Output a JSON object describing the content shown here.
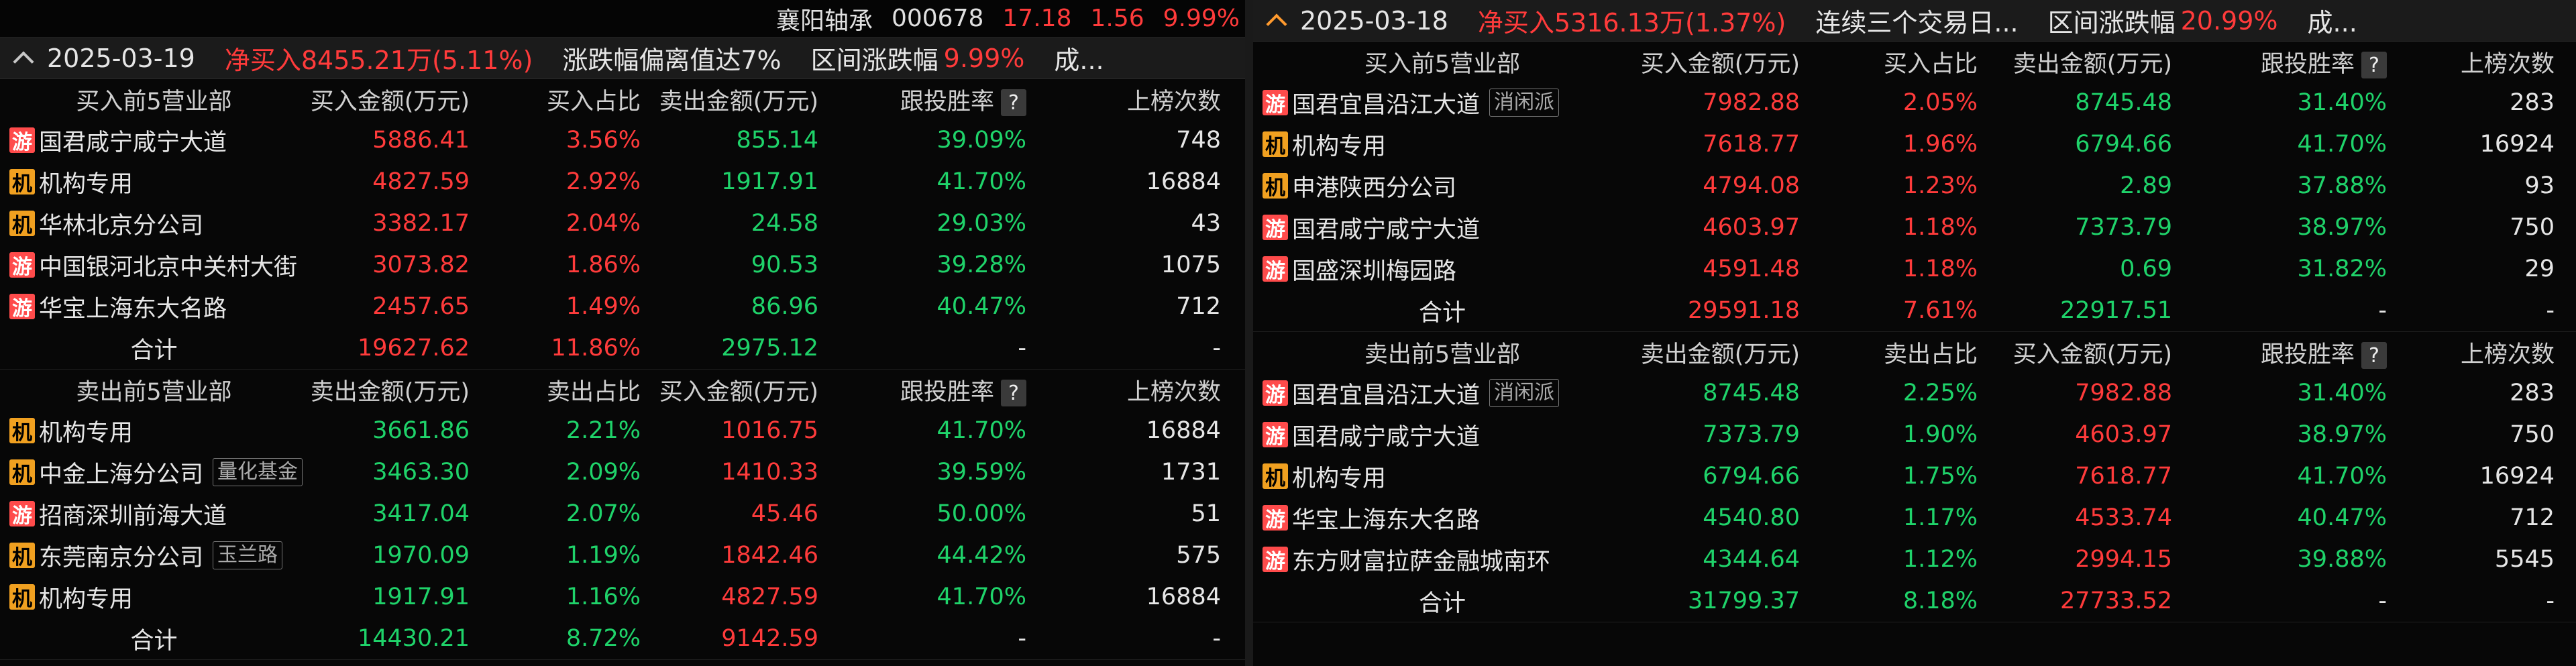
{
  "stock": {
    "name": "襄阳轴承",
    "code": "000678",
    "price": "17.18",
    "change": "1.56",
    "pct": "9.99%"
  },
  "left": {
    "date": "2025-03-19",
    "net": "净买入8455.21万(5.11%)",
    "reason": "涨跌幅偏离值达7%",
    "range_label": "区间涨跌幅",
    "range_value": "9.99%",
    "more": "成...",
    "buy": {
      "headers": [
        "买入前5营业部",
        "买入金额(万元)",
        "买入占比",
        "卖出金额(万元)",
        "跟投胜率",
        "上榜次数"
      ],
      "rows": [
        {
          "tag": "游",
          "name": "国君咸宁咸宁大道",
          "badge": "",
          "a": "5886.41",
          "p": "3.56%",
          "b": "855.14",
          "w": "39.09%",
          "n": "748"
        },
        {
          "tag": "机",
          "name": "机构专用",
          "badge": "",
          "a": "4827.59",
          "p": "2.92%",
          "b": "1917.91",
          "w": "41.70%",
          "n": "16884"
        },
        {
          "tag": "机",
          "name": "华林北京分公司",
          "badge": "",
          "a": "3382.17",
          "p": "2.04%",
          "b": "24.58",
          "w": "29.03%",
          "n": "43"
        },
        {
          "tag": "游",
          "name": "中国银河北京中关村大街",
          "badge": "",
          "a": "3073.82",
          "p": "1.86%",
          "b": "90.53",
          "w": "39.28%",
          "n": "1075"
        },
        {
          "tag": "游",
          "name": "华宝上海东大名路",
          "badge": "",
          "a": "2457.65",
          "p": "1.49%",
          "b": "86.96",
          "w": "40.47%",
          "n": "712"
        }
      ],
      "total": {
        "name": "合计",
        "a": "19627.62",
        "p": "11.86%",
        "b": "2975.12",
        "w": "-",
        "n": "-"
      }
    },
    "sell": {
      "headers": [
        "卖出前5营业部",
        "卖出金额(万元)",
        "卖出占比",
        "买入金额(万元)",
        "跟投胜率",
        "上榜次数"
      ],
      "rows": [
        {
          "tag": "机",
          "name": "机构专用",
          "badge": "",
          "a": "3661.86",
          "p": "2.21%",
          "b": "1016.75",
          "w": "41.70%",
          "n": "16884"
        },
        {
          "tag": "机",
          "name": "中金上海分公司",
          "badge": "量化基金",
          "a": "3463.30",
          "p": "2.09%",
          "b": "1410.33",
          "w": "39.59%",
          "n": "1731"
        },
        {
          "tag": "游",
          "name": "招商深圳前海大道",
          "badge": "",
          "a": "3417.04",
          "p": "2.07%",
          "b": "45.46",
          "w": "50.00%",
          "n": "51"
        },
        {
          "tag": "机",
          "name": "东莞南京分公司",
          "badge": "玉兰路",
          "a": "1970.09",
          "p": "1.19%",
          "b": "1842.46",
          "w": "44.42%",
          "n": "575"
        },
        {
          "tag": "机",
          "name": "机构专用",
          "badge": "",
          "a": "1917.91",
          "p": "1.16%",
          "b": "4827.59",
          "w": "41.70%",
          "n": "16884"
        }
      ],
      "total": {
        "name": "合计",
        "a": "14430.21",
        "p": "8.72%",
        "b": "9142.59",
        "w": "-",
        "n": "-"
      }
    }
  },
  "right": {
    "date": "2025-03-18",
    "net": "净买入5316.13万(1.37%)",
    "reason": "连续三个交易日...",
    "range_label": "区间涨跌幅",
    "range_value": "20.99%",
    "more": "成...",
    "buy": {
      "headers": [
        "买入前5营业部",
        "买入金额(万元)",
        "买入占比",
        "卖出金额(万元)",
        "跟投胜率",
        "上榜次数"
      ],
      "rows": [
        {
          "tag": "游",
          "name": "国君宜昌沿江大道",
          "badge": "消闲派",
          "a": "7982.88",
          "p": "2.05%",
          "b": "8745.48",
          "w": "31.40%",
          "n": "283"
        },
        {
          "tag": "机",
          "name": "机构专用",
          "badge": "",
          "a": "7618.77",
          "p": "1.96%",
          "b": "6794.66",
          "w": "41.70%",
          "n": "16924"
        },
        {
          "tag": "机",
          "name": "申港陕西分公司",
          "badge": "",
          "a": "4794.08",
          "p": "1.23%",
          "b": "2.89",
          "w": "37.88%",
          "n": "93"
        },
        {
          "tag": "游",
          "name": "国君咸宁咸宁大道",
          "badge": "",
          "a": "4603.97",
          "p": "1.18%",
          "b": "7373.79",
          "w": "38.97%",
          "n": "750"
        },
        {
          "tag": "游",
          "name": "国盛深圳梅园路",
          "badge": "",
          "a": "4591.48",
          "p": "1.18%",
          "b": "0.69",
          "w": "31.82%",
          "n": "29"
        }
      ],
      "total": {
        "name": "合计",
        "a": "29591.18",
        "p": "7.61%",
        "b": "22917.51",
        "w": "-",
        "n": "-"
      }
    },
    "sell": {
      "headers": [
        "卖出前5营业部",
        "卖出金额(万元)",
        "卖出占比",
        "买入金额(万元)",
        "跟投胜率",
        "上榜次数"
      ],
      "rows": [
        {
          "tag": "游",
          "name": "国君宜昌沿江大道",
          "badge": "消闲派",
          "a": "8745.48",
          "p": "2.25%",
          "b": "7982.88",
          "w": "31.40%",
          "n": "283"
        },
        {
          "tag": "游",
          "name": "国君咸宁咸宁大道",
          "badge": "",
          "a": "7373.79",
          "p": "1.90%",
          "b": "4603.97",
          "w": "38.97%",
          "n": "750"
        },
        {
          "tag": "机",
          "name": "机构专用",
          "badge": "",
          "a": "6794.66",
          "p": "1.75%",
          "b": "7618.77",
          "w": "41.70%",
          "n": "16924"
        },
        {
          "tag": "游",
          "name": "华宝上海东大名路",
          "badge": "",
          "a": "4540.80",
          "p": "1.17%",
          "b": "4533.74",
          "w": "40.47%",
          "n": "712"
        },
        {
          "tag": "游",
          "name": "东方财富拉萨金融城南环",
          "badge": "",
          "a": "4344.64",
          "p": "1.12%",
          "b": "2994.15",
          "w": "39.88%",
          "n": "5545"
        }
      ],
      "total": {
        "name": "合计",
        "a": "31799.37",
        "p": "8.18%",
        "b": "27733.52",
        "w": "-",
        "n": "-"
      }
    }
  },
  "colors": {
    "red": "#ff3b3b",
    "green": "#1fd36a",
    "tag_you": "#ff4b4b",
    "tag_ji": "#f0a020",
    "accent": "#ff9a2e"
  },
  "icons": {
    "collapse": "chevron-up-icon",
    "help": "question-icon"
  },
  "help_glyph": "?"
}
